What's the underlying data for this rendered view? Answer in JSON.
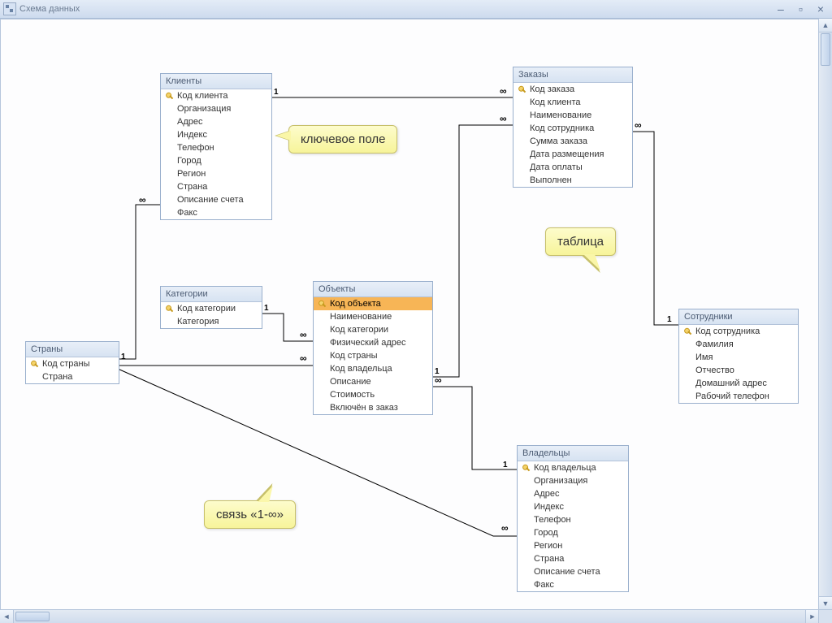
{
  "window": {
    "title": "Схема данных"
  },
  "callouts": {
    "keyfield": "ключевое поле",
    "table": "таблица",
    "relation": "связь «1-∞»"
  },
  "relation_symbols": {
    "one": "1",
    "many": "∞"
  },
  "tables": {
    "countries": {
      "title": "Страны",
      "fields": [
        {
          "name": "Код страны",
          "key": true
        },
        {
          "name": "Страна",
          "key": false
        }
      ]
    },
    "clients": {
      "title": "Клиенты",
      "fields": [
        {
          "name": "Код клиента",
          "key": true
        },
        {
          "name": "Организация",
          "key": false
        },
        {
          "name": "Адрес",
          "key": false
        },
        {
          "name": "Индекс",
          "key": false
        },
        {
          "name": "Телефон",
          "key": false
        },
        {
          "name": "Город",
          "key": false
        },
        {
          "name": "Регион",
          "key": false
        },
        {
          "name": "Страна",
          "key": false
        },
        {
          "name": "Описание счета",
          "key": false
        },
        {
          "name": "Факс",
          "key": false
        }
      ]
    },
    "categories": {
      "title": "Категории",
      "fields": [
        {
          "name": "Код категории",
          "key": true
        },
        {
          "name": "Категория",
          "key": false
        }
      ]
    },
    "objects": {
      "title": "Объекты",
      "selected_index": 0,
      "fields": [
        {
          "name": "Код объекта",
          "key": true
        },
        {
          "name": "Наименование",
          "key": false
        },
        {
          "name": "Код категории",
          "key": false
        },
        {
          "name": "Физический адрес",
          "key": false
        },
        {
          "name": "Код страны",
          "key": false
        },
        {
          "name": "Код владельца",
          "key": false
        },
        {
          "name": "Описание",
          "key": false
        },
        {
          "name": "Стоимость",
          "key": false
        },
        {
          "name": "Включён в заказ",
          "key": false
        }
      ]
    },
    "orders": {
      "title": "Заказы",
      "fields": [
        {
          "name": "Код заказа",
          "key": true
        },
        {
          "name": "Код клиента",
          "key": false
        },
        {
          "name": "Наименование",
          "key": false
        },
        {
          "name": "Код сотрудника",
          "key": false
        },
        {
          "name": "Сумма заказа",
          "key": false
        },
        {
          "name": "Дата размещения",
          "key": false
        },
        {
          "name": "Дата оплаты",
          "key": false
        },
        {
          "name": "Выполнен",
          "key": false
        }
      ]
    },
    "employees": {
      "title": "Сотрудники",
      "fields": [
        {
          "name": "Код сотрудника",
          "key": true
        },
        {
          "name": "Фамилия",
          "key": false
        },
        {
          "name": "Имя",
          "key": false
        },
        {
          "name": "Отчество",
          "key": false
        },
        {
          "name": "Домашний адрес",
          "key": false
        },
        {
          "name": "Рабочий телефон",
          "key": false
        }
      ]
    },
    "owners": {
      "title": "Владельцы",
      "fields": [
        {
          "name": "Код владельца",
          "key": true
        },
        {
          "name": "Организация",
          "key": false
        },
        {
          "name": "Адрес",
          "key": false
        },
        {
          "name": "Индекс",
          "key": false
        },
        {
          "name": "Телефон",
          "key": false
        },
        {
          "name": "Город",
          "key": false
        },
        {
          "name": "Регион",
          "key": false
        },
        {
          "name": "Страна",
          "key": false
        },
        {
          "name": "Описание счета",
          "key": false
        },
        {
          "name": "Факс",
          "key": false
        }
      ]
    }
  }
}
